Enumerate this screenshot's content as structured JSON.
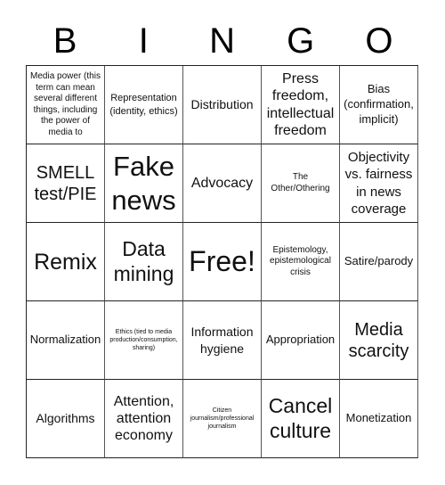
{
  "header": {
    "letters": [
      "B",
      "I",
      "N",
      "G",
      "O"
    ]
  },
  "grid": {
    "rows": [
      [
        {
          "text": "Media power (this term can mean several different things, including the power of media to"
        },
        {
          "text": "Representation (identity, ethics)"
        },
        {
          "text": "Distribution"
        },
        {
          "text": "Press freedom, intellectual freedom"
        },
        {
          "text": "Bias (confirmation, implicit)"
        }
      ],
      [
        {
          "text": "SMELL test/PIE"
        },
        {
          "text": "Fake news"
        },
        {
          "text": "Advocacy"
        },
        {
          "text": "The Other/Othering"
        },
        {
          "text": "Objectivity vs. fairness in news coverage"
        }
      ],
      [
        {
          "text": "Remix"
        },
        {
          "text": "Data mining"
        },
        {
          "text": "Free!"
        },
        {
          "text": "Epistemology, epistemological crisis"
        },
        {
          "text": "Satire/parody"
        }
      ],
      [
        {
          "text": "Normalization"
        },
        {
          "text": "Ethics (tied to media production/consumption, sharing)"
        },
        {
          "text": "Information hygiene"
        },
        {
          "text": "Appropriation"
        },
        {
          "text": "Media scarcity"
        }
      ],
      [
        {
          "text": "Algorithms"
        },
        {
          "text": "Attention, attention economy"
        },
        {
          "text": "Citizen journalism/professional journalism"
        },
        {
          "text": "Cancel culture"
        },
        {
          "text": "Monetization"
        }
      ]
    ],
    "free_space": {
      "row": 2,
      "col": 2
    }
  }
}
